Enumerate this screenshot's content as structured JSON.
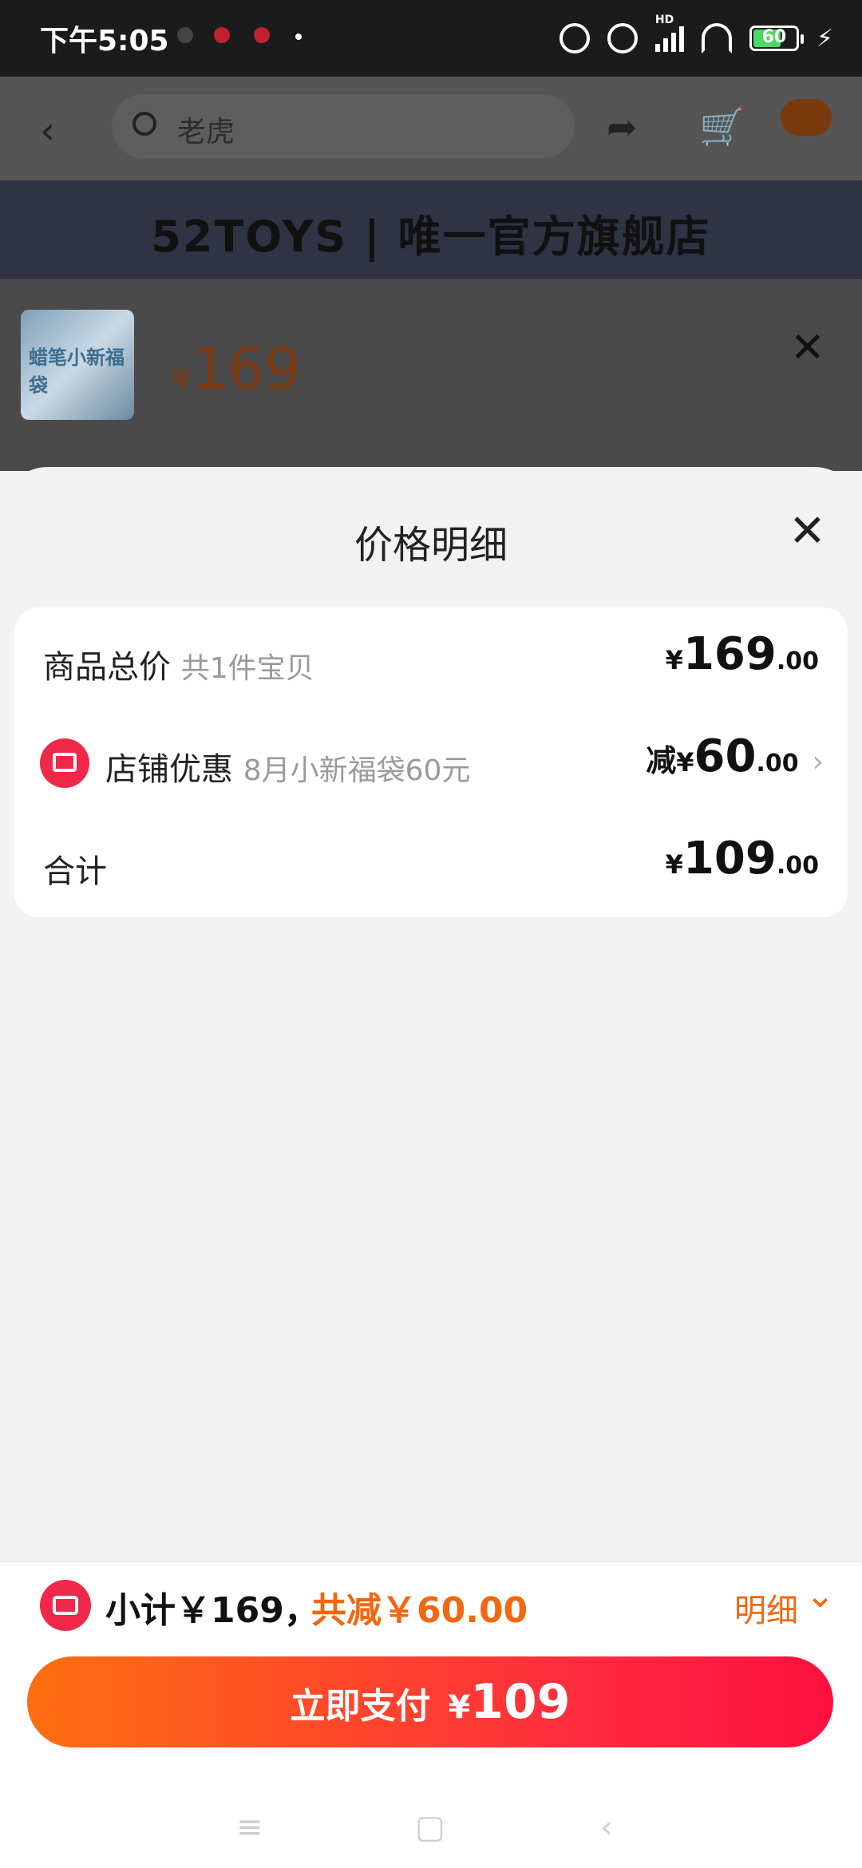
{
  "status_bar": {
    "time": "下午5:05",
    "battery": "60",
    "hd": "HD"
  },
  "header": {
    "search_placeholder": "老虎"
  },
  "banner": {
    "text": "52TOYS | 唯一官方旗舰店"
  },
  "product": {
    "currency": "¥",
    "price": "169",
    "thumb_label": "蜡笔小新福袋"
  },
  "sheet": {
    "title": "价格明细",
    "rows": [
      {
        "label": "商品总价",
        "sub": "共1件宝贝",
        "currency": "¥",
        "int": "169",
        "dec": ".00"
      },
      {
        "label": "店铺优惠",
        "sub": "8月小新福袋60元",
        "prefix": "减",
        "currency": "¥",
        "int": "60",
        "dec": ".00"
      },
      {
        "label": "合计",
        "currency": "¥",
        "int": "109",
        "dec": ".00"
      }
    ]
  },
  "bottom": {
    "subtotal": "小计￥169，",
    "saving": "共减￥60.00",
    "detail_label": "明细",
    "pay_label": "立即支付",
    "pay_currency": "¥",
    "pay_amount": "109"
  },
  "colors": {
    "accent": "#f2670f",
    "brand_red": "#f0284a"
  }
}
